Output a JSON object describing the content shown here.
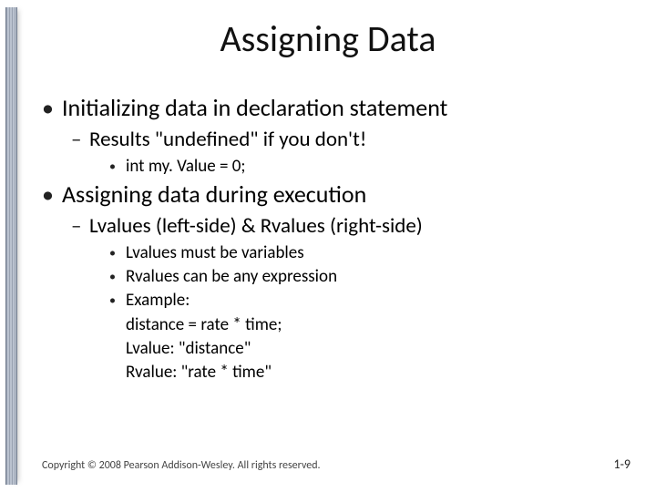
{
  "title": "Assigning Data",
  "bullets": {
    "b1": "Initializing data in declaration statement",
    "b1_1": "Results \"undefined\" if you don't!",
    "b1_1_1": "int my. Value = 0;",
    "b2": "Assigning data during execution",
    "b2_1": "Lvalues (left-side) & Rvalues (right-side)",
    "b2_1_1": "Lvalues must be variables",
    "b2_1_2": "Rvalues can be any expression",
    "b2_1_3": "Example:",
    "b2_1_3a": "distance = rate * time;",
    "b2_1_3b": "Lvalue:  \"distance\"",
    "b2_1_3c": "Rvalue: \"rate * time\""
  },
  "footer": {
    "copyright": "Copyright © 2008 Pearson Addison-Wesley. All rights reserved.",
    "page": "1-9"
  }
}
